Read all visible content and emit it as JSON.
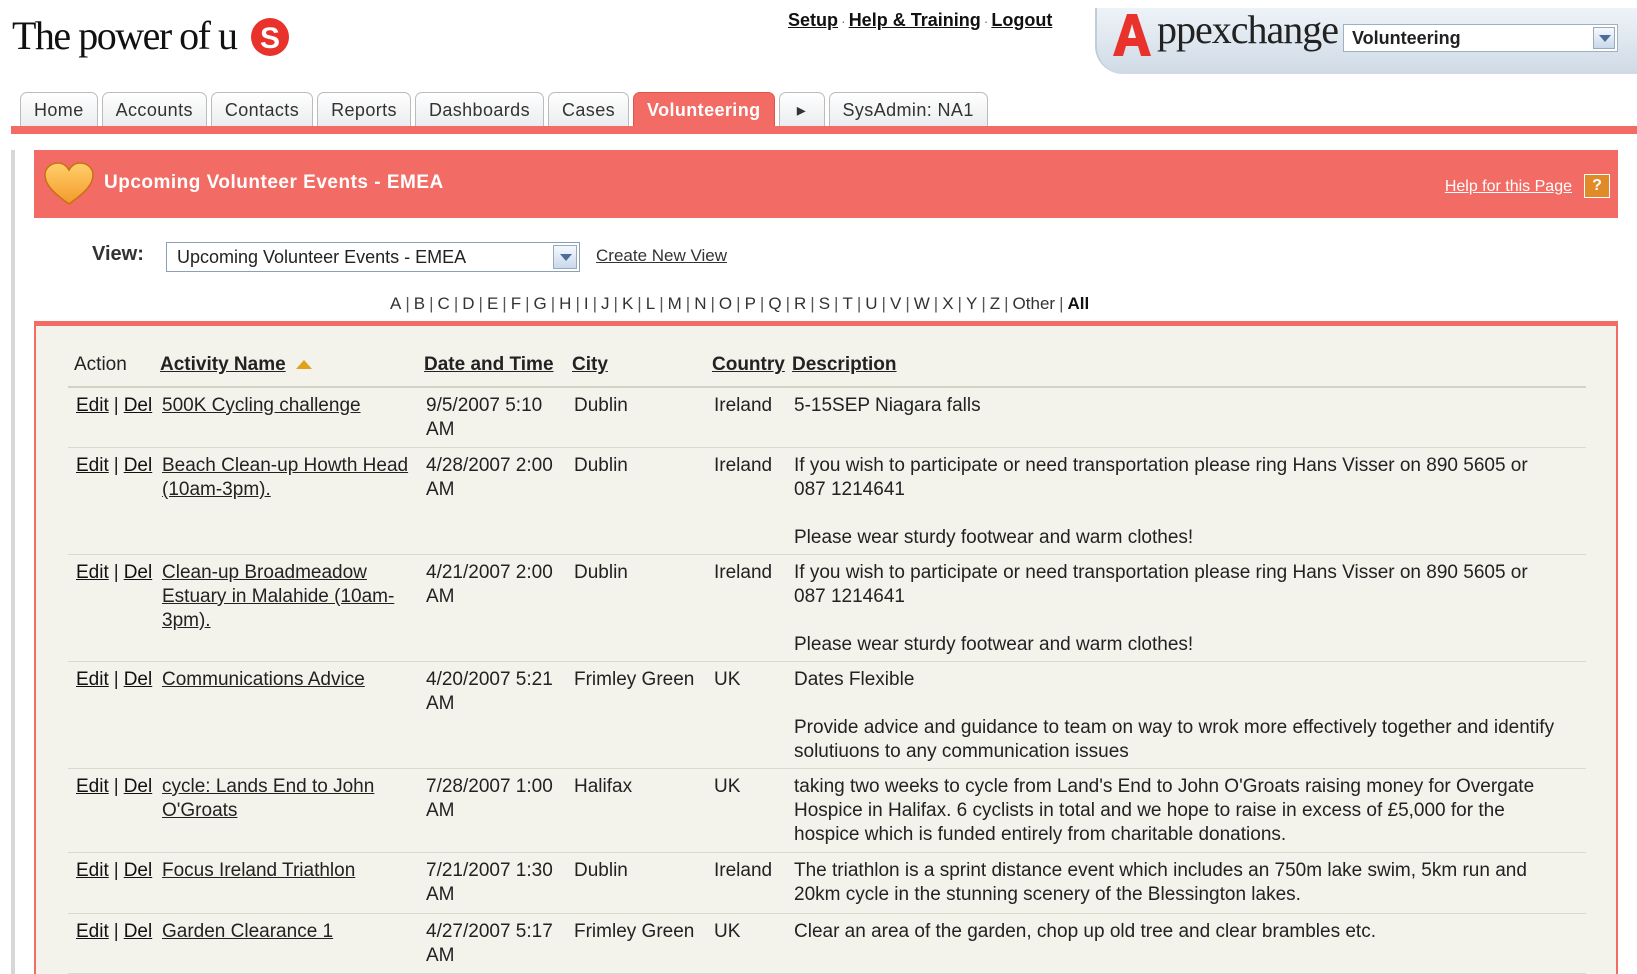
{
  "header": {
    "logo_text": "The power of u",
    "links": [
      "Setup",
      "Help & Training",
      "Logout"
    ],
    "appexchange_text": "ppexchange",
    "app_selected": "Volunteering"
  },
  "tabs": [
    "Home",
    "Accounts",
    "Contacts",
    "Reports",
    "Dashboards",
    "Cases",
    "Volunteering",
    "▸",
    "SysAdmin: NA1"
  ],
  "active_tab": "Volunteering",
  "page": {
    "title": "Upcoming Volunteer Events - EMEA",
    "help_link": "Help for this Page",
    "help_icon": "?",
    "view_label": "View:",
    "view_selected": "Upcoming Volunteer Events - EMEA",
    "create_view": "Create New View"
  },
  "alphabet": [
    "A",
    "B",
    "C",
    "D",
    "E",
    "F",
    "G",
    "H",
    "I",
    "J",
    "K",
    "L",
    "M",
    "N",
    "O",
    "P",
    "Q",
    "R",
    "S",
    "T",
    "U",
    "V",
    "W",
    "X",
    "Y",
    "Z",
    "Other",
    "All"
  ],
  "table": {
    "headers": {
      "action": "Action",
      "name": "Activity Name",
      "date": "Date and Time",
      "city": "City",
      "country": "Country",
      "description": "Description"
    },
    "edit_label": "Edit",
    "sep": "|",
    "del_label": "Del",
    "rows": [
      {
        "name": "500K Cycling challenge",
        "date": "9/5/2007 5:10 AM",
        "city": "Dublin",
        "country": "Ireland",
        "description": "5-15SEP Niagara falls"
      },
      {
        "name": "Beach Clean-up Howth Head (10am-3pm).",
        "date": "4/28/2007 2:00 AM",
        "city": "Dublin",
        "country": "Ireland",
        "description": "If you wish to participate or need transportation please ring Hans Visser on 890 5605 or 087 1214641\n\nPlease wear sturdy footwear and warm clothes!"
      },
      {
        "name": "Clean-up Broadmeadow Estuary in Malahide (10am-3pm).",
        "date": "4/21/2007 2:00 AM",
        "city": "Dublin",
        "country": "Ireland",
        "description": "If you wish to participate or need transportation please ring Hans Visser on 890 5605 or 087 1214641\n\nPlease wear sturdy footwear and warm clothes!"
      },
      {
        "name": "Communications Advice",
        "date": "4/20/2007 5:21 AM",
        "city": "Frimley Green",
        "country": "UK",
        "description": "Dates Flexible\n\nProvide advice and guidance to team on way to wrok more effectively together and identify solutiuons to any communication issues"
      },
      {
        "name": "cycle: Lands End to John O'Groats",
        "date": "7/28/2007 1:00 AM",
        "city": "Halifax",
        "country": "UK",
        "description": "taking two weeks to cycle from Land's End to John O'Groats raising money for Overgate Hospice in Halifax. 6 cyclists in total and we hope to raise in excess of £5,000 for the hospice which is funded entirely from charitable donations."
      },
      {
        "name": "Focus Ireland Triathlon",
        "date": "7/21/2007 1:30 AM",
        "city": "Dublin",
        "country": "Ireland",
        "description": "The triathlon is a sprint distance event which includes an 750m lake swim, 5km run and 20km cycle in the stunning scenery of the Blessington lakes."
      },
      {
        "name": "Garden Clearance 1",
        "date": "4/27/2007 5:17 AM",
        "city": "Frimley Green",
        "country": "UK",
        "description": "Clear an area of the garden, chop up old tree and clear brambles etc."
      }
    ]
  },
  "colors": {
    "accent": "#f26b64",
    "list_bg": "#f3f3ec",
    "sort_arrow": "#e0a21a",
    "help_icon": "#e08a28"
  }
}
